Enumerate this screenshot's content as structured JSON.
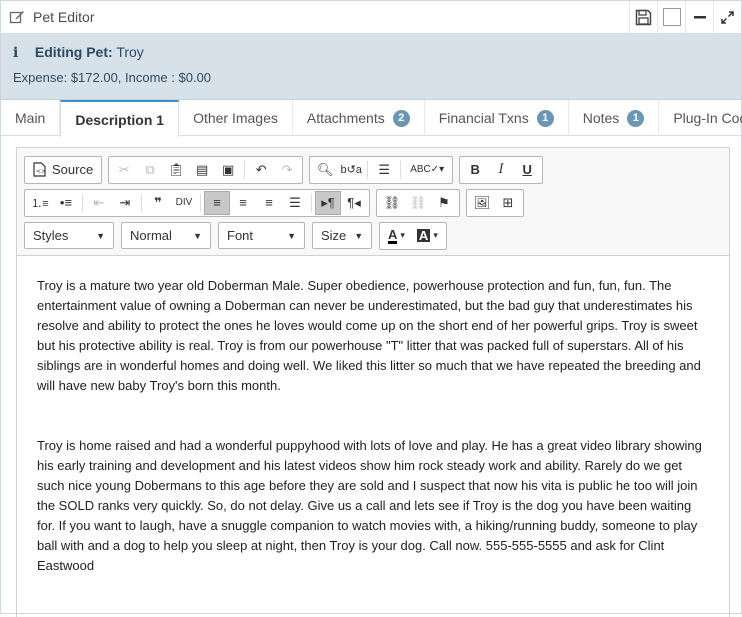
{
  "window": {
    "title": "Pet Editor"
  },
  "info": {
    "editing_label": "Editing Pet:",
    "pet_name": "Troy",
    "expense_income": "Expense: $172.00, Income : $0.00"
  },
  "tabs": [
    {
      "label": "Main",
      "badge": null
    },
    {
      "label": "Description 1",
      "badge": null,
      "active": true
    },
    {
      "label": "Other Images",
      "badge": null
    },
    {
      "label": "Attachments",
      "badge": "2"
    },
    {
      "label": "Financial Txns",
      "badge": "1"
    },
    {
      "label": "Notes",
      "badge": "1"
    },
    {
      "label": "Plug-In Code",
      "badge": null
    }
  ],
  "toolbar": {
    "source_label": "Source",
    "styles": "Styles",
    "format": "Normal",
    "font": "Font",
    "size": "Size"
  },
  "content": {
    "paragraphs": [
      "Troy is a mature two year old Doberman Male. Super obedience, powerhouse protection and fun, fun, fun. The entertainment value of owning a Doberman can never be underestimated, but the bad guy that underestimates his resolve and ability to protect the ones he loves would come up on the short end of her powerful grips. Troy is sweet but his protective ability is real. Troy is from our powerhouse \"T\" litter that was packed full of superstars. All of his siblings are in wonderful homes and doing well. We liked this litter so much that we have repeated the breeding and will have new baby Troy's born this month.",
      "Troy is home raised and had a wonderful puppyhood with lots of love and play. He has a great video library showing his early training and development and his latest videos show him rock steady work and ability. Rarely do we get such nice young Dobermans to this age before they are sold and I suspect that now his vita is public he too will join the SOLD ranks very quickly. So, do not delay. Give us a call and lets see if Troy is the dog you have been waiting for. If you want to laugh, have a snuggle companion to watch movies with, a hiking/running buddy, someone to play ball with and a dog to help you sleep at night, then Troy is your dog. Call now. 555-555-5555 and ask for Clint Eastwood"
    ]
  },
  "icons": {
    "title": "edit-icon",
    "save": "save-icon",
    "maximize": "maximize-box-icon",
    "minimize": "minimize-icon",
    "expand": "expand-icon",
    "info": "info-icon"
  }
}
